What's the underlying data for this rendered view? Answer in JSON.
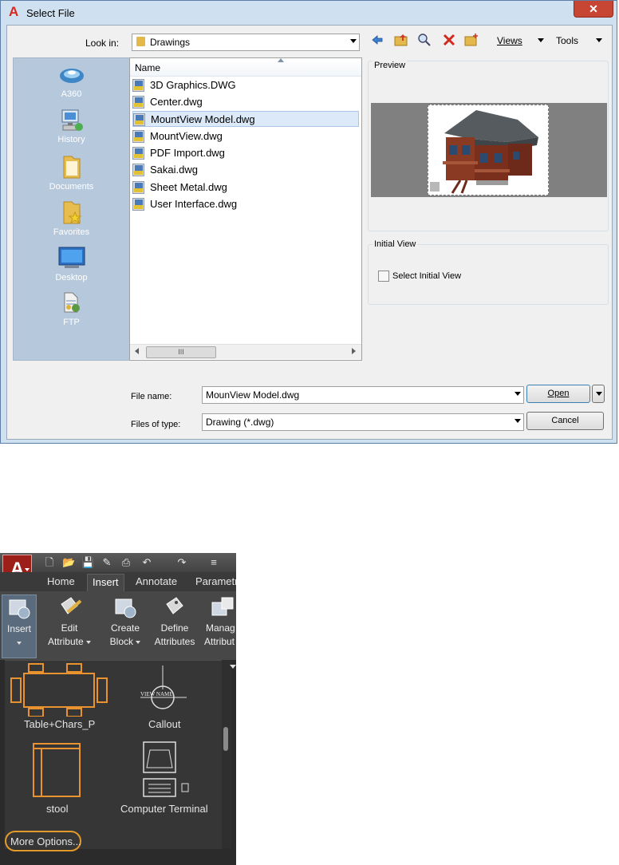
{
  "dialog": {
    "title": "Select File",
    "close_glyph": "✕",
    "look_in_label": "Look in:",
    "look_in_value": "Drawings",
    "toolbar": {
      "views_label": "Views",
      "tools_label": "Tools",
      "icons": [
        "back-icon",
        "up-folder-icon",
        "search-web-icon",
        "delete-icon",
        "new-folder-icon"
      ]
    },
    "places": [
      {
        "label": "A360",
        "icon": "cloud-icon"
      },
      {
        "label": "History",
        "icon": "history-icon"
      },
      {
        "label": "Documents",
        "icon": "documents-folder-icon"
      },
      {
        "label": "Favorites",
        "icon": "favorites-folder-icon"
      },
      {
        "label": "Desktop",
        "icon": "desktop-monitor-icon"
      },
      {
        "label": "FTP",
        "icon": "ftp-icon"
      }
    ],
    "file_list": {
      "column_header": "Name",
      "files": [
        {
          "name": "3D Graphics.DWG",
          "selected": false
        },
        {
          "name": "Center.dwg",
          "selected": false
        },
        {
          "name": "MountView Model.dwg",
          "selected": true
        },
        {
          "name": "MountView.dwg",
          "selected": false
        },
        {
          "name": "PDF Import.dwg",
          "selected": false
        },
        {
          "name": "Sakai.dwg",
          "selected": false
        },
        {
          "name": "Sheet Metal.dwg",
          "selected": false
        },
        {
          "name": "User Interface.dwg",
          "selected": false
        }
      ],
      "scroll_thumb_glyph": "III"
    },
    "preview_label": "Preview",
    "initial_view_label": "Initial View",
    "select_initial_view_label": "Select Initial View",
    "file_name_label": "File name:",
    "file_name_value": "MounView Model.dwg",
    "files_of_type_label": "Files of type:",
    "files_of_type_value": "Drawing (*.dwg)",
    "open_button": "Open",
    "cancel_button": "Cancel"
  },
  "autocad": {
    "app_button_letter": "A",
    "tabs": [
      "Home",
      "Insert",
      "Annotate",
      "Parametr"
    ],
    "active_tab": "Insert",
    "ribbon_buttons": [
      {
        "line1": "Insert",
        "line2": ""
      },
      {
        "line1": "Edit",
        "line2": "Attribute"
      },
      {
        "line1": "Create",
        "line2": "Block"
      },
      {
        "line1": "Define",
        "line2": "Attributes"
      },
      {
        "line1": "Manag",
        "line2": "Attribut"
      }
    ],
    "gallery_items": [
      "Table+Chars_P",
      "Callout",
      "stool",
      "Computer Terminal"
    ],
    "callout_art_text": "VIEW NAME",
    "more_options": "More Options..."
  },
  "colors": {
    "dialog_frame": "#cfe0f1",
    "places_bar": "#b6c8dc",
    "selection": "#dbe9f8",
    "autocad_dark": "#2b2b2b",
    "block_orange": "#e8932f",
    "highlight_ring": "#e39a2b"
  }
}
